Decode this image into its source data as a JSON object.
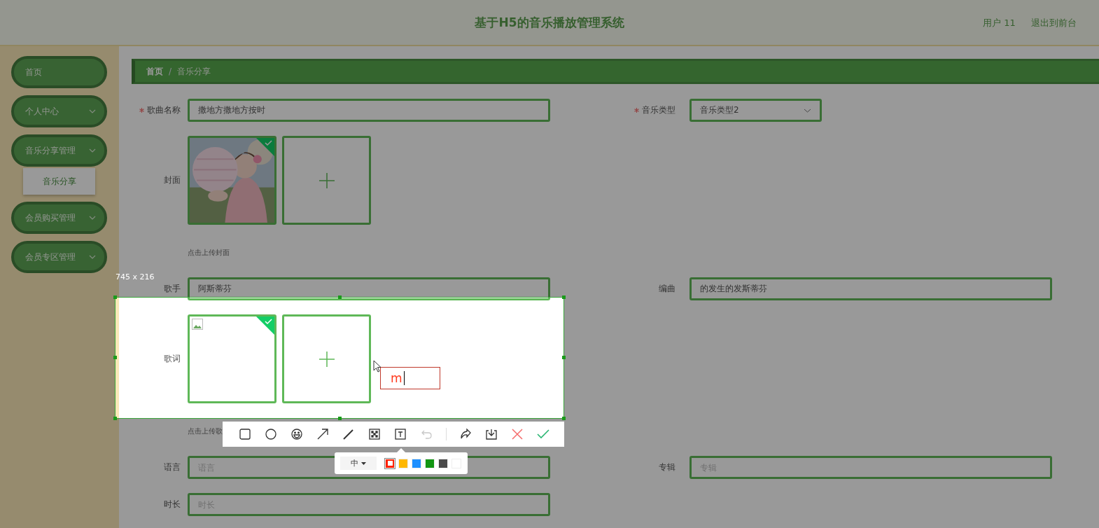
{
  "header": {
    "title": "基于H5的音乐播放管理系统",
    "user": "用户 11",
    "links": [
      "退出到前台"
    ]
  },
  "sidebar": {
    "items": [
      {
        "label": "首页",
        "kind": "link"
      },
      {
        "label": "个人中心",
        "kind": "submenu"
      },
      {
        "label": "音乐分享管理",
        "kind": "submenu",
        "children": [
          {
            "label": "音乐分享",
            "selected": true
          }
        ]
      },
      {
        "label": "会员购买管理",
        "kind": "submenu"
      },
      {
        "label": "会员专区管理",
        "kind": "submenu"
      }
    ]
  },
  "breadcrumb": {
    "items": [
      "首页",
      "音乐分享"
    ],
    "separator": "/"
  },
  "form": {
    "rows": [
      {
        "kind": "fields",
        "fields": [
          {
            "label": "歌曲名称",
            "required": true,
            "kind": "text",
            "value": "撒地方撒地方按时"
          },
          {
            "label": "音乐类型",
            "required": true,
            "kind": "select",
            "value": "音乐类型2"
          }
        ]
      },
      {
        "kind": "upload",
        "label": "封面",
        "hint": "点击上传封面"
      },
      {
        "kind": "fields",
        "fields": [
          {
            "label": "歌手",
            "required": false,
            "kind": "text",
            "value": "阿斯蒂芬"
          },
          {
            "label": "编曲",
            "required": false,
            "kind": "text",
            "value": "的发生的发斯蒂芬"
          }
        ]
      },
      {
        "kind": "upload",
        "label": "歌词",
        "images": [
          {
            "kind": "broken"
          }
        ],
        "hint": "点击上传歌"
      },
      {
        "kind": "fields",
        "fields": [
          {
            "label": "语言",
            "required": false,
            "kind": "text",
            "placeholder": "语言"
          },
          {
            "label": "专辑",
            "required": false,
            "kind": "text",
            "placeholder": "专辑"
          }
        ]
      },
      {
        "kind": "fields",
        "fields": [
          {
            "label": "时长",
            "required": false,
            "kind": "text",
            "placeholder": "时长"
          }
        ]
      }
    ]
  },
  "capture": {
    "size": "745 x 216",
    "tools": [
      {
        "kind": "rectangle",
        "disabled": false
      },
      {
        "kind": "ellipse",
        "disabled": false
      },
      {
        "kind": "emoji",
        "disabled": false
      },
      {
        "kind": "arrow",
        "disabled": false
      },
      {
        "kind": "pen",
        "disabled": false
      },
      {
        "kind": "mosaic",
        "disabled": false
      },
      {
        "kind": "text",
        "disabled": false
      },
      {
        "kind": "undo",
        "disabled": true
      }
    ],
    "actions": [
      {
        "kind": "redo",
        "disabled": false
      },
      {
        "kind": "save",
        "disabled": false
      },
      {
        "kind": "cancel",
        "disabled": false
      },
      {
        "kind": "confirm",
        "disabled": false
      }
    ],
    "font_size": "中",
    "colors": [
      {
        "color": "#ff2200",
        "selected": true
      },
      {
        "color": "#ffb800",
        "selected": false
      },
      {
        "color": "#1e90ff",
        "selected": false
      },
      {
        "color": "#129612",
        "selected": false
      },
      {
        "color": "#4a4a4a",
        "selected": false
      },
      {
        "color": "#ffffff",
        "selected": false
      }
    ],
    "text_box": {
      "value": "m"
    }
  }
}
